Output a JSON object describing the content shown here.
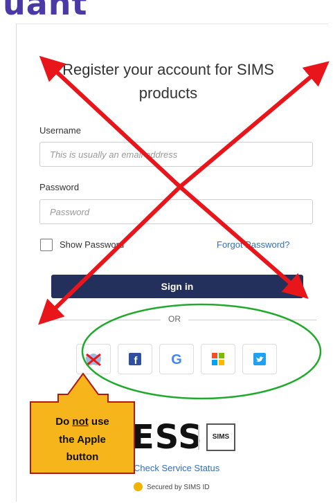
{
  "header": {
    "partial_word": "uant"
  },
  "form": {
    "title": "Register your account for SIMS products",
    "username_label": "Username",
    "username_placeholder": "This is usually an email address",
    "password_label": "Password",
    "password_placeholder": "Password",
    "show_password_label": "Show Password",
    "forgot_password_link": "Forgot Password?",
    "sign_in_button": "Sign in",
    "or_text": "OR"
  },
  "social_buttons": [
    {
      "icon": "apple-icon"
    },
    {
      "icon": "facebook-icon"
    },
    {
      "icon": "google-icon"
    },
    {
      "icon": "microsoft-icon"
    },
    {
      "icon": "twitter-icon"
    }
  ],
  "footer": {
    "logo_text": "ESS",
    "sims_badge": "SIMS",
    "status_link": "Check Service Status",
    "secured_text": "Secured by SIMS ID"
  },
  "annotation": {
    "line1_pre": "Do ",
    "line1_emph": "not",
    "line1_post": " use",
    "line2": "the Apple",
    "line3": "button"
  },
  "colors": {
    "signin_bg": "#23305c",
    "link": "#2d6fc1",
    "arrow_red": "#e8161b",
    "ellipse_green": "#1faa2b",
    "callout_fill": "#f6b51a"
  }
}
